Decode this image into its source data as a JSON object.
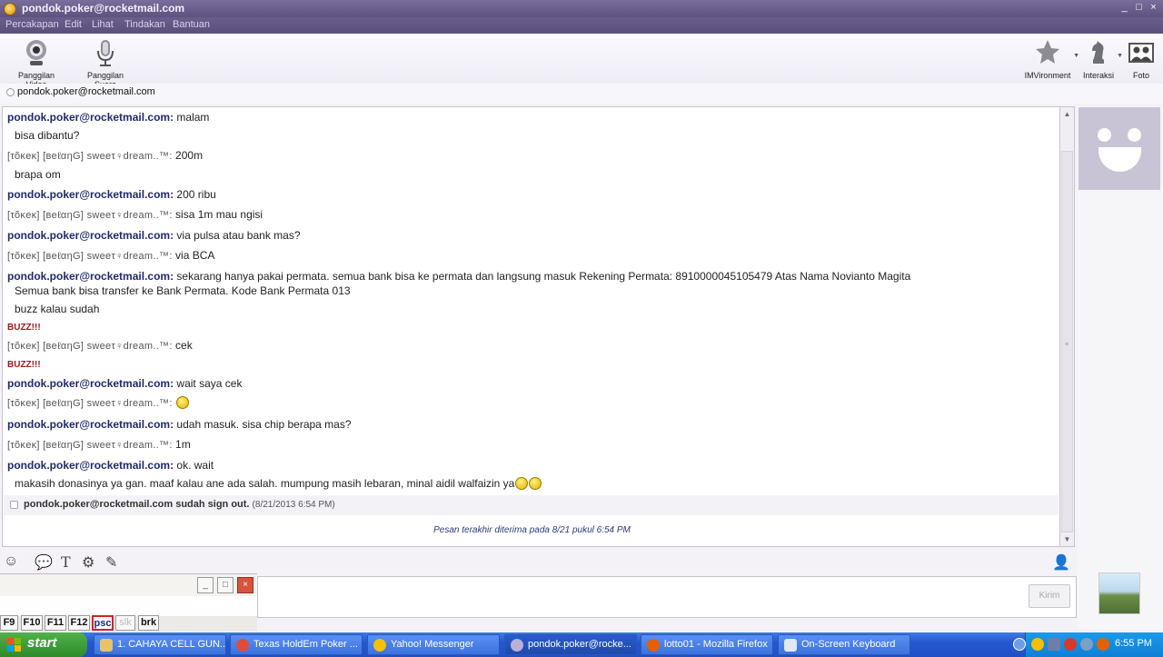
{
  "window": {
    "title": "pondok.poker@rocketmail.com"
  },
  "menu": [
    "Percakapan",
    "Edit",
    "Lihat",
    "Tindakan",
    "Bantuan"
  ],
  "toolbar": {
    "video_call": "Panggilan Video",
    "voice_call": "Panggilan Suara",
    "imvironment": "IMVironment",
    "interaksi": "Interaksi",
    "foto": "Foto"
  },
  "contact": {
    "name": "pondok.poker@rocketmail.com"
  },
  "conversation": [
    {
      "sender": "pondok.poker@rocketmail.com:",
      "text": "malam"
    },
    {
      "text": "bisa dibantu?"
    },
    {
      "sender": "[τõκeκ] [вeℓαηG] sweeτ♀dream..™:",
      "text": "200m"
    },
    {
      "text": "brapa om"
    },
    {
      "sender": "pondok.poker@rocketmail.com:",
      "text": "200 ribu"
    },
    {
      "sender": "[τõκeκ] [вeℓαηG] sweeτ♀dream..™:",
      "text": "sisa 1m mau ngisi"
    },
    {
      "sender": "pondok.poker@rocketmail.com:",
      "text": "via pulsa atau bank mas?"
    },
    {
      "sender": "[τõκeκ] [вeℓαηG] sweeτ♀dream..™:",
      "text": "via BCA"
    },
    {
      "sender": "pondok.poker@rocketmail.com:",
      "text": "sekarang hanya pakai permata. semua bank bisa ke permata dan langsung masuk Rekening Permata: 8910000045105479 Atas Nama Novianto Magita"
    },
    {
      "text": "Semua bank bisa transfer ke Bank Permata. Kode Bank Permata 013"
    },
    {
      "text": "buzz kalau sudah"
    },
    {
      "buzz": "BUZZ!!!"
    },
    {
      "sender": "[τõκeκ] [вeℓαηG] sweeτ♀dream..™:",
      "text": "cek"
    },
    {
      "buzz": "BUZZ!!!"
    },
    {
      "sender": "pondok.poker@rocketmail.com:",
      "text": "wait saya cek"
    },
    {
      "sender": "[τõκeκ] [вeℓαηG] sweeτ♀dream..™:",
      "text": ""
    },
    {
      "sender": "pondok.poker@rocketmail.com:",
      "text": "udah masuk. sisa chip berapa mas?"
    },
    {
      "sender": "[τõκeκ] [вeℓαηG] sweeτ♀dream..™:",
      "text": "1m"
    },
    {
      "sender": "pondok.poker@rocketmail.com:",
      "text": "ok. wait"
    },
    {
      "text": "makasih donasinya ya gan. maaf kalau ane ada salah. mumpung masih lebaran, minal aidil walfaizin ya"
    }
  ],
  "signout": {
    "text": "pondok.poker@rocketmail.com sudah sign out.",
    "time": "(8/21/2013 6:54 PM)"
  },
  "last_message": "Pesan terakhir diterima pada 8/21 pukul 6:54 PM",
  "send_button": "Kirim",
  "osk_keys": [
    "F9",
    "F10",
    "F11",
    "F12",
    "psc",
    "slk",
    "brk"
  ],
  "taskbar": {
    "start": "start",
    "tasks": [
      "1. CAHAYA CELL GUN...",
      "Texas HoldEm Poker ...",
      "Yahoo! Messenger",
      "pondok.poker@rocke...",
      "lotto01 - Mozilla Firefox",
      "On-Screen Keyboard"
    ],
    "clock": "6:55 PM"
  }
}
